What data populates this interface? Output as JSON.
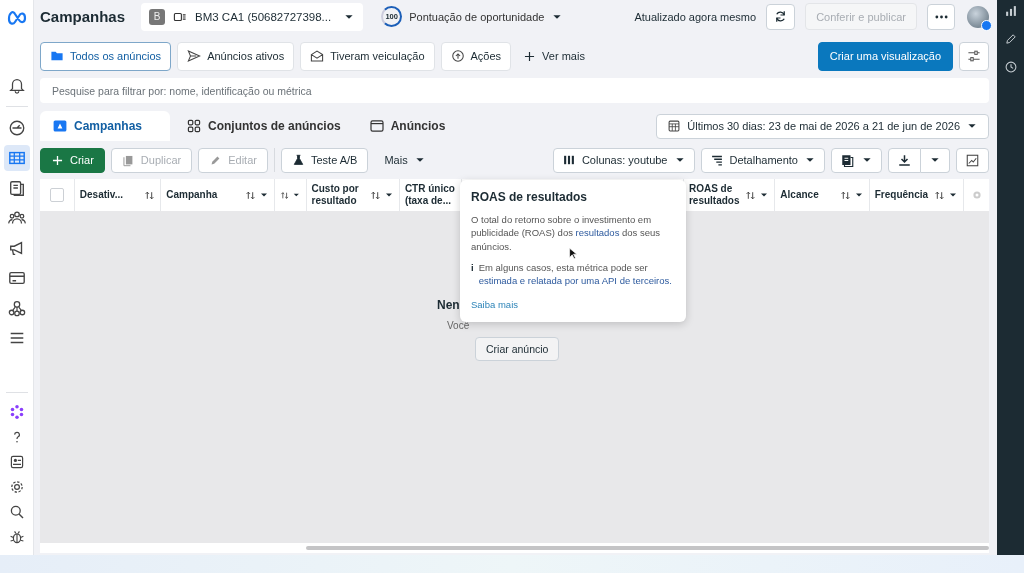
{
  "sidebar": {
    "items": [
      {
        "selected": false
      },
      {
        "selected": false
      },
      {
        "selected": true
      },
      {
        "selected": false
      },
      {
        "selected": false
      },
      {
        "selected": false
      },
      {
        "selected": false
      },
      {
        "selected": false
      },
      {
        "selected": false
      }
    ],
    "bottom_items": [
      {
        "selected": false
      },
      {
        "selected": false
      },
      {
        "selected": false
      },
      {
        "selected": false
      },
      {
        "selected": false
      },
      {
        "selected": false
      }
    ]
  },
  "app_bar": {
    "title": "Campanhas",
    "account_initial": "B",
    "account_name": "BM3 CA1 (50682727398...",
    "opportunity_score": "100",
    "opportunity_label": "Pontuação de oportunidade",
    "status": "Atualizado agora mesmo",
    "publish_button": {
      "label": "Conferir e publicar",
      "disabled": true
    }
  },
  "filter_tabs": [
    {
      "label": "Todos os anúncios",
      "kind": "folder",
      "selected": true
    },
    {
      "label": "Anúncios ativos",
      "kind": "send",
      "selected": false
    },
    {
      "label": "Tiveram veiculação",
      "kind": "mail",
      "selected": false
    },
    {
      "label": "Ações",
      "kind": "action",
      "selected": false
    }
  ],
  "see_more": "Ver mais",
  "create_view_button": "Criar uma visualização",
  "search": {
    "placeholder": "Pesquise para filtrar por: nome, identificação ou métrica"
  },
  "level_tabs": [
    {
      "label": "Campanhas",
      "kind": "campaign",
      "selected": true
    },
    {
      "label": "Conjuntos de anúncios",
      "kind": "adset",
      "selected": false
    },
    {
      "label": "Anúncios",
      "kind": "ad",
      "selected": false
    }
  ],
  "date_range": "Últimos 30 dias: 23 de mai de 2026 a 21 de jun de 2026",
  "toolbar": {
    "buttons": [
      {
        "label": "Criar",
        "kind": "create",
        "disabled": false
      },
      {
        "label": "Duplicar",
        "kind": "duplicate",
        "disabled": true
      },
      {
        "label": "Editar",
        "kind": "edit",
        "disabled": true
      },
      {
        "label": "Teste A/B",
        "kind": "test",
        "disabled": false
      }
    ],
    "more_menu": "Mais",
    "columns_button": "Colunas: youtube",
    "breakdown_button": "Detalhamento"
  },
  "table": {
    "select_all": {
      "checked": false
    },
    "columns": [
      {
        "label": "Desativ..."
      },
      {
        "label": "Campanha"
      },
      {},
      {
        "label": "Custo por resultado"
      },
      {
        "label": "CTR único (taxa de..."
      },
      {
        "label": "ROAS de resultados"
      },
      {
        "label": "Alcance"
      },
      {
        "label": "Frequência"
      }
    ],
    "empty_state": {
      "title": "Nen",
      "subtitle": "Você",
      "button": "Criar anúncio"
    }
  },
  "tooltip": {
    "title": "ROAS de resultados",
    "body": {
      "before": "O total do retorno sobre o investimento em publicidade (ROAS) dos ",
      "link": "resultados",
      "after": " dos seus anúncios."
    },
    "note": {
      "before": "Em alguns casos, esta métrica pode ser ",
      "link": "estimada e relatada por uma API de terceiros."
    },
    "info_mark": "i",
    "link": "Saiba mais"
  }
}
